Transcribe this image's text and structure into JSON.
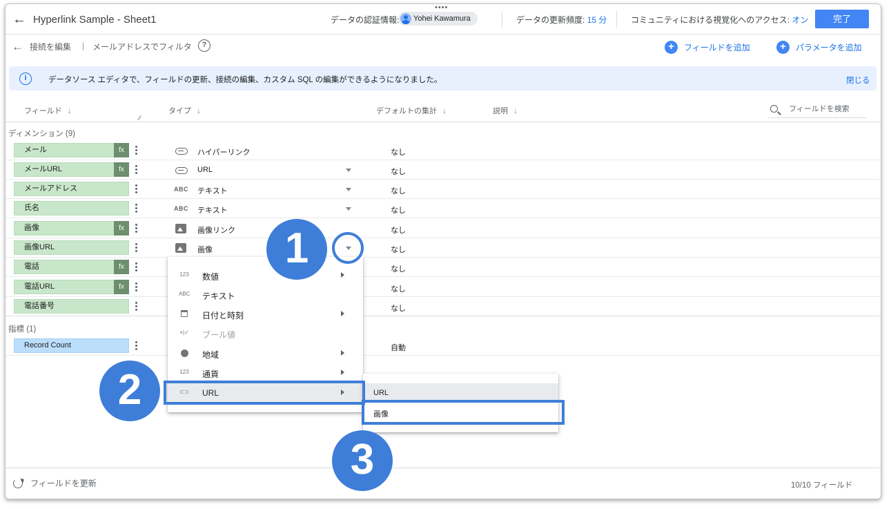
{
  "header": {
    "title": "Hyperlink Sample - Sheet1",
    "credentials_label": "データの認証情報:",
    "credentials_user": "Yohei Kawamura",
    "freshness_label": "データの更新頻度:",
    "freshness_value": "15 分",
    "community_label": "コミュニティにおける視覚化へのアクセス:",
    "community_value": "オン",
    "done_label": "完了"
  },
  "subheader": {
    "edit_connection": "接続を編集",
    "divider": "|",
    "filter_by_email": "メールアドレスでフィルタ",
    "help_icon": "?",
    "add_field": "フィールドを追加",
    "add_parameter": "パラメータを追加"
  },
  "banner": {
    "message": "データソース エディタで、フィールドの更新、接続の編集、カスタム SQL の編集ができるようになりました。",
    "close": "閉じる"
  },
  "table_header": {
    "field": "フィールド",
    "type": "タイプ",
    "default_agg": "デフォルトの集計",
    "description": "説明",
    "search_placeholder": "フィールドを検索"
  },
  "dimensions_title": "ディメンション (9)",
  "metrics_title": "指標 (1)",
  "dimensions": [
    {
      "name": "メール",
      "fx": "fx",
      "type_icon": "ABC",
      "type": "ハイパーリンク",
      "agg": "なし"
    },
    {
      "name": "メールURL",
      "fx": "fx",
      "type_icon": "ABC",
      "type": "URL",
      "agg": "なし"
    },
    {
      "name": "メールアドレス",
      "fx": "",
      "type_icon": "ABC",
      "type": "テキスト",
      "agg": "なし"
    },
    {
      "name": "氏名",
      "fx": "",
      "type_icon": "ABC",
      "type": "テキスト",
      "agg": "なし"
    },
    {
      "name": "画像",
      "fx": "fx",
      "type_icon": "ABC",
      "type": "画像リンク",
      "agg": "なし"
    },
    {
      "name": "画像URL",
      "fx": "",
      "type_icon": "ABC",
      "type": "画像",
      "agg": "なし"
    },
    {
      "name": "電話",
      "fx": "fx",
      "type_icon": "ABC",
      "type": "",
      "agg": "なし"
    },
    {
      "name": "電話URL",
      "fx": "fx",
      "type_icon": "ABC",
      "type": "",
      "agg": "なし"
    },
    {
      "name": "電話番号",
      "fx": "",
      "type_icon": "ABC",
      "type": "",
      "agg": "なし"
    }
  ],
  "metrics": [
    {
      "name": "Record Count",
      "agg": "自動"
    }
  ],
  "type_menu": {
    "items": [
      {
        "icon": "123",
        "label": "数値"
      },
      {
        "icon": "ABC",
        "label": "テキスト"
      },
      {
        "icon": "",
        "label": "日付と時刻"
      },
      {
        "icon": "×|✓",
        "label": "ブール値"
      },
      {
        "icon": "",
        "label": "地域"
      },
      {
        "icon": "123",
        "label": "通貨"
      },
      {
        "icon": "",
        "label": "URL"
      }
    ]
  },
  "url_submenu": {
    "items": [
      "URL",
      "画像"
    ]
  },
  "footer": {
    "refresh": "フィールドを更新",
    "count": "10/10 フィールド"
  },
  "annotations": [
    "1",
    "2",
    "3"
  ],
  "colors": {
    "accent": "#4285f4",
    "dimension_chip": "#c8e6c9",
    "metric_chip": "#bbdefb",
    "annotation": "#3e7ed8"
  }
}
